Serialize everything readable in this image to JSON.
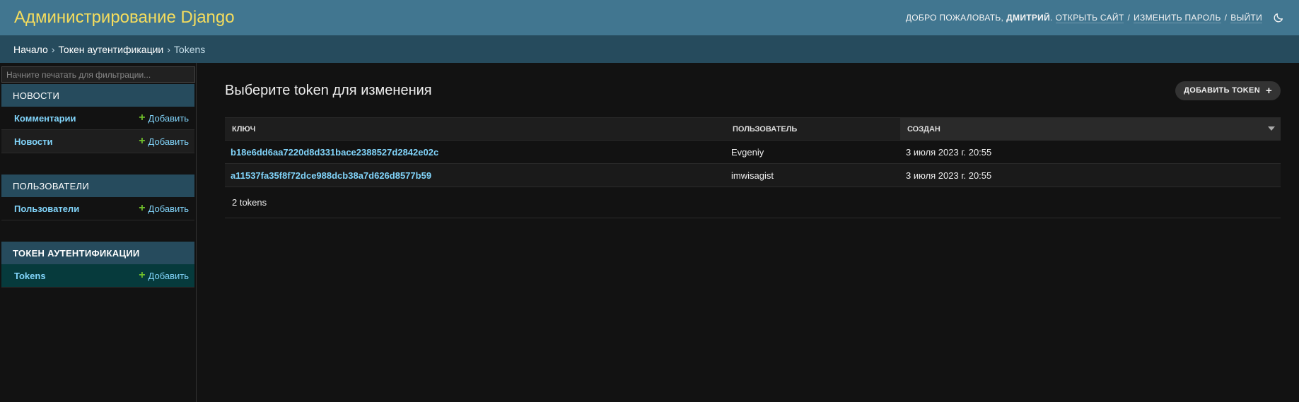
{
  "header": {
    "site_title": "Администрирование Django",
    "welcome": "Добро пожаловать,",
    "username": "Дмитрий",
    "punct": ".",
    "view_site": "Открыть сайт",
    "change_password": "Изменить пароль",
    "logout": "Выйти",
    "sep": "/",
    "theme_icon": "moon-icon"
  },
  "breadcrumbs": {
    "home": "Начало",
    "app": "Токен аутентификации",
    "current": "Tokens",
    "sep": "›"
  },
  "sidebar": {
    "filter_placeholder": "Начните печатать для фильтрации...",
    "modules": [
      {
        "caption": "Новости",
        "models": [
          {
            "name": "Комментарии",
            "add": "Добавить"
          },
          {
            "name": "Новости",
            "add": "Добавить"
          }
        ]
      },
      {
        "caption": "Пользователи",
        "models": [
          {
            "name": "Пользователи",
            "add": "Добавить"
          }
        ]
      },
      {
        "caption": "Токен аутентификации",
        "models": [
          {
            "name": "Tokens",
            "add": "Добавить"
          }
        ]
      }
    ]
  },
  "content": {
    "title": "Выберите token для изменения",
    "add_button": "Добавить token",
    "columns": [
      "Ключ",
      "Пользователь",
      "Создан"
    ],
    "rows": [
      {
        "key": "b18e6dd6aa7220d8d331bace2388527d2842e02c",
        "user": "Evgeniy",
        "created": "3 июля 2023 г. 20:55"
      },
      {
        "key": "a11537fa35f8f72dce988dcb38a7d626d8577b59",
        "user": "imwisagist",
        "created": "3 июля 2023 г. 20:55"
      }
    ],
    "count": "2 tokens"
  },
  "colors": {
    "header_bg": "#417690",
    "breadcrumb_bg": "#264b5d",
    "title_color": "#f5dd5d",
    "link_color": "#81d4fa",
    "add_plus": "#70bf2b",
    "current_model_bg": "#063a3c"
  }
}
